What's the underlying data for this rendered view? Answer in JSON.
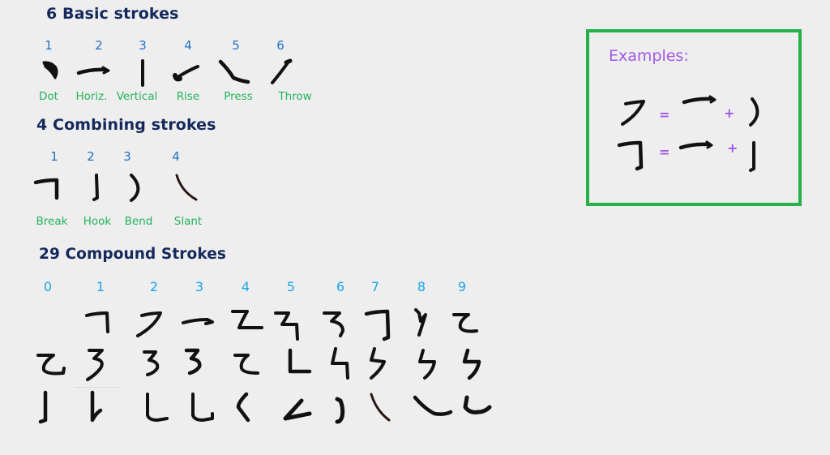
{
  "sections": {
    "basic": {
      "title": "6 Basic strokes",
      "items": [
        {
          "num": "1",
          "label": "Dot",
          "icon": "dot-stroke-icon"
        },
        {
          "num": "2",
          "label": "Horiz.",
          "icon": "horizontal-stroke-icon"
        },
        {
          "num": "3",
          "label": "Vertical",
          "icon": "vertical-stroke-icon"
        },
        {
          "num": "4",
          "label": "Rise",
          "icon": "rise-stroke-icon"
        },
        {
          "num": "5",
          "label": "Press",
          "icon": "press-stroke-icon"
        },
        {
          "num": "6",
          "label": "Throw",
          "icon": "throw-stroke-icon"
        }
      ]
    },
    "combining": {
      "title": "4 Combining strokes",
      "items": [
        {
          "num": "1",
          "label": "Break",
          "icon": "break-stroke-icon"
        },
        {
          "num": "2",
          "label": "Hook",
          "icon": "hook-stroke-icon"
        },
        {
          "num": "3",
          "label": "Bend",
          "icon": "bend-stroke-icon"
        },
        {
          "num": "4",
          "label": "Slant",
          "icon": "slant-stroke-icon"
        }
      ]
    },
    "compound": {
      "title": "29 Compound Strokes",
      "column_numbers": [
        "0",
        "1",
        "2",
        "3",
        "4",
        "5",
        "6",
        "7",
        "8",
        "9"
      ],
      "rows": [
        [
          "",
          "compound-stroke-01",
          "compound-stroke-02",
          "compound-stroke-03",
          "compound-stroke-04",
          "compound-stroke-05",
          "compound-stroke-06",
          "compound-stroke-07",
          "compound-stroke-08",
          "compound-stroke-09"
        ],
        [
          "compound-stroke-10",
          "compound-stroke-11",
          "compound-stroke-12",
          "compound-stroke-13",
          "compound-stroke-14",
          "compound-stroke-15",
          "compound-stroke-16",
          "compound-stroke-17",
          "compound-stroke-18",
          "compound-stroke-19"
        ],
        [
          "compound-stroke-20",
          "compound-stroke-21",
          "compound-stroke-22",
          "compound-stroke-23",
          "compound-stroke-24",
          "compound-stroke-25",
          "compound-stroke-26",
          "compound-stroke-27",
          "compound-stroke-28",
          "compound-stroke-29"
        ]
      ]
    },
    "examples": {
      "title": "Examples:",
      "equals": "=",
      "plus": "+",
      "rows": [
        {
          "result": "horizontal-bend-stroke",
          "parts": [
            "horizontal-stroke",
            "bend-stroke"
          ]
        },
        {
          "result": "horizontal-break-hook-stroke",
          "parts": [
            "horizontal-stroke",
            "hook-stroke"
          ]
        }
      ]
    }
  },
  "colors": {
    "heading": "#14285c",
    "basic_number": "#1f73c4",
    "compound_number": "#1aa3ea",
    "label": "#22b35a",
    "examples_border": "#25b04a",
    "examples_accent": "#a258e6",
    "background": "#eeeeee"
  }
}
